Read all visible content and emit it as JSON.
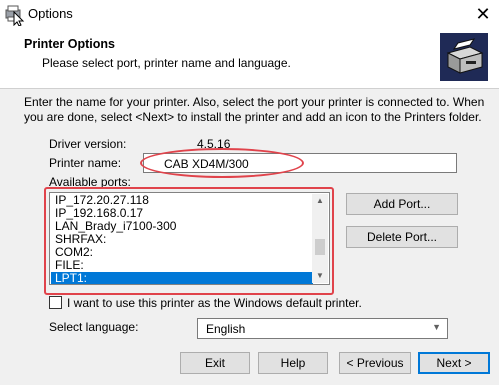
{
  "window": {
    "title": "Options",
    "close_glyph": "✕"
  },
  "header": {
    "title": "Printer Options",
    "subtitle": "Please select port, printer name and language."
  },
  "intro_text": "Enter the name for your printer. Also, select the port your printer is connected to. When you are done, select <Next> to install the printer and add an icon to the Printers folder.",
  "driver": {
    "label": "Driver version:",
    "value": "4.5.16"
  },
  "printer_name": {
    "label": "Printer name:",
    "value": "CAB XD4M/300"
  },
  "ports": {
    "label": "Available ports:",
    "items": [
      "IP_172.20.27.118",
      "IP_192.168.0.17",
      "LAN_Brady_i7100-300",
      "SHRFAX:",
      "COM2:",
      "FILE:",
      "LPT1:"
    ],
    "selected": "LPT1:"
  },
  "buttons": {
    "add_port": "Add Port...",
    "delete_port": "Delete Port...",
    "exit": "Exit",
    "help": "Help",
    "previous": "< Previous",
    "next": "Next >"
  },
  "default_checkbox": {
    "label": "I want to use this printer as the Windows default printer.",
    "checked": false
  },
  "language": {
    "label": "Select language:",
    "value": "English"
  },
  "colors": {
    "accent": "#0078d7",
    "highlight_annotation": "#e0434b"
  },
  "icons": {
    "app": "printer-cursor-icon",
    "header": "printer-icon"
  }
}
